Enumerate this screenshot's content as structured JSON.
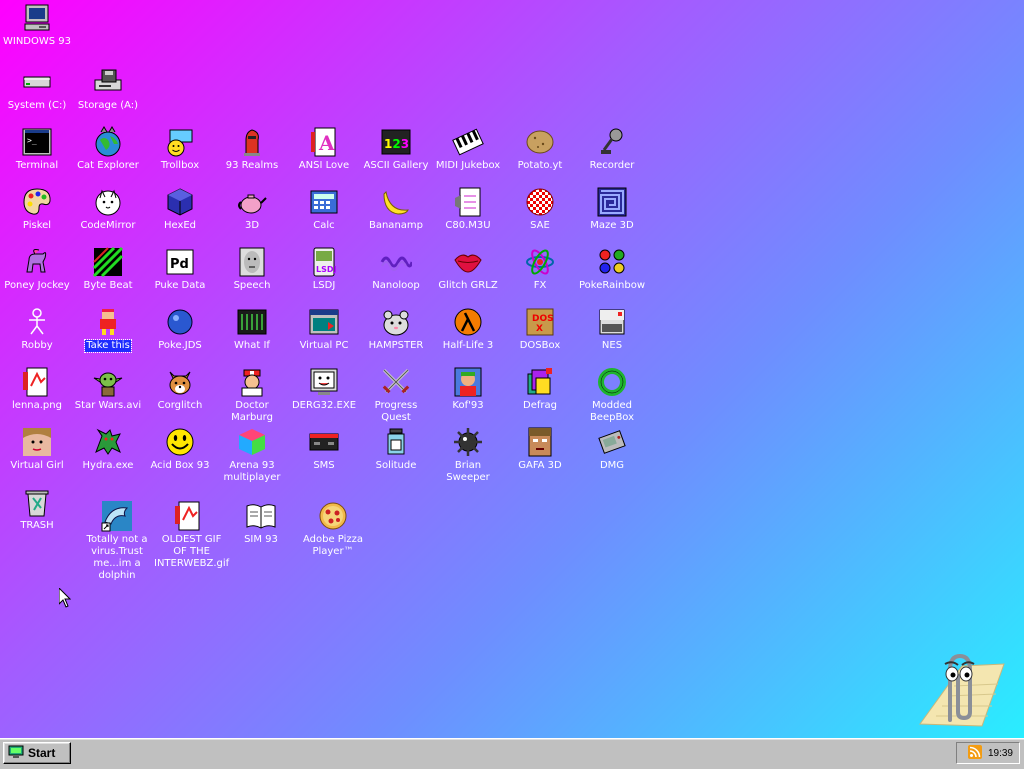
{
  "desktop_icons": [
    {
      "label": "WINDOWS 93",
      "icon": "computer-icon"
    },
    {
      "label": "System (C:)",
      "icon": "drive-icon"
    },
    {
      "label": "Storage (A:)",
      "icon": "floppy-drive-icon"
    },
    {
      "label": "Terminal",
      "icon": "terminal-icon"
    },
    {
      "label": "Cat Explorer",
      "icon": "globe-cat-icon"
    },
    {
      "label": "Trollbox",
      "icon": "chat-smiley-icon"
    },
    {
      "label": "93 Realms",
      "icon": "knight-icon"
    },
    {
      "label": "ANSI Love",
      "icon": "ansi-letter-icon"
    },
    {
      "label": "ASCII Gallery",
      "icon": "ascii-123-icon"
    },
    {
      "label": "MIDI Jukebox",
      "icon": "piano-keys-icon"
    },
    {
      "label": "Potato.yt",
      "icon": "potato-icon"
    },
    {
      "label": "Recorder",
      "icon": "microphone-icon"
    },
    {
      "label": "Piskel",
      "icon": "palette-icon"
    },
    {
      "label": "CodeMirror",
      "icon": "cat-sketch-icon"
    },
    {
      "label": "HexEd",
      "icon": "cube-icon"
    },
    {
      "label": "3D",
      "icon": "teapot-icon"
    },
    {
      "label": "Calc",
      "icon": "calculator-icon"
    },
    {
      "label": "Bananamp",
      "icon": "banana-icon"
    },
    {
      "label": "C80.M3U",
      "icon": "playlist-icon"
    },
    {
      "label": "SAE",
      "icon": "amiga-ball-icon"
    },
    {
      "label": "Maze 3D",
      "icon": "maze-icon"
    },
    {
      "label": "Poney Jockey",
      "icon": "pony-icon"
    },
    {
      "label": "Byte Beat",
      "icon": "bytebeat-icon"
    },
    {
      "label": "Puke Data",
      "icon": "pd-icon"
    },
    {
      "label": "Speech",
      "icon": "face-icon"
    },
    {
      "label": "LSDJ",
      "icon": "lsdj-icon"
    },
    {
      "label": "Nanoloop",
      "icon": "wave-icon"
    },
    {
      "label": "Glitch GRLZ",
      "icon": "lips-icon"
    },
    {
      "label": "FX",
      "icon": "atom-icon"
    },
    {
      "label": "PokeRainbow",
      "icon": "trainers-icon"
    },
    {
      "label": "Robby",
      "icon": "stick-figure-icon"
    },
    {
      "label": "Take this",
      "icon": "pixel-character-icon"
    },
    {
      "label": "Poke.JDS",
      "icon": "blue-ball-icon"
    },
    {
      "label": "What If",
      "icon": "what-if-icon"
    },
    {
      "label": "Virtual PC",
      "icon": "window-icon"
    },
    {
      "label": "HAMPSTER",
      "icon": "hamster-icon"
    },
    {
      "label": "Half-Life 3",
      "icon": "lambda-icon"
    },
    {
      "label": "DOSBox",
      "icon": "dosbox-icon"
    },
    {
      "label": "NES",
      "icon": "nes-console-icon"
    },
    {
      "label": "lenna.png",
      "icon": "image-file-icon"
    },
    {
      "label": "Star Wars.avi",
      "icon": "yoda-icon"
    },
    {
      "label": "Corglitch",
      "icon": "corgi-icon"
    },
    {
      "label": "Doctor Marburg",
      "icon": "doctor-icon"
    },
    {
      "label": "DERG32.EXE",
      "icon": "screen-face-icon"
    },
    {
      "label": "Progress Quest",
      "icon": "swords-icon"
    },
    {
      "label": "Kof'93",
      "icon": "fighter-icon"
    },
    {
      "label": "Defrag",
      "icon": "defrag-icon"
    },
    {
      "label": "Modded BeepBox",
      "icon": "ring-icon"
    },
    {
      "label": "Virtual Girl",
      "icon": "girl-face-icon"
    },
    {
      "label": "Hydra.exe",
      "icon": "dragon-icon"
    },
    {
      "label": "Acid Box 93",
      "icon": "acid-smiley-icon"
    },
    {
      "label": "Arena 93 multiplayer",
      "icon": "color-cube-icon"
    },
    {
      "label": "SMS",
      "icon": "sms-console-icon"
    },
    {
      "label": "Solitude",
      "icon": "jar-icon"
    },
    {
      "label": "Brian Sweeper",
      "icon": "mine-icon"
    },
    {
      "label": "GAFA 3D",
      "icon": "soldier-face-icon"
    },
    {
      "label": "DMG",
      "icon": "gameboy-icon"
    },
    {
      "label": "TRASH",
      "icon": "trash-icon"
    },
    {
      "label": "Totally not a virus.Trust me...im a dolphin",
      "icon": "dolphin-icon"
    },
    {
      "label": "OLDEST GIF OF THE INTERWEBZ.gif",
      "icon": "gif-file-icon"
    },
    {
      "label": "SIM 93",
      "icon": "book-icon"
    },
    {
      "label": "Adobe Pizza Player™",
      "icon": "pizza-icon"
    }
  ],
  "taskbar": {
    "start_label": "Start",
    "clock": "19:39"
  },
  "colors": {
    "gradient_top_left": "#ff00ff",
    "gradient_bottom_right": "#26f2ff",
    "taskbar": "#c0c0c0",
    "selection": "#1e2cff"
  }
}
